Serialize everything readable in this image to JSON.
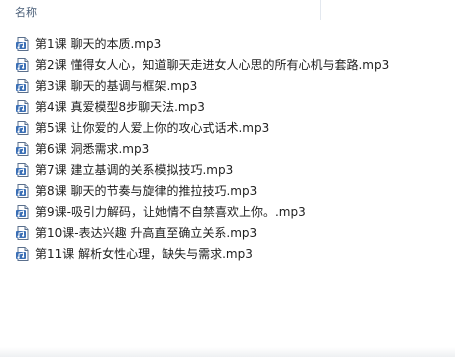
{
  "header": {
    "name_column_label": "名称"
  },
  "files": [
    {
      "name": "第1课 聊天的本质.mp3",
      "icon": "audio-file-icon"
    },
    {
      "name": "第2课 懂得女人心，知道聊天走进女人心思的所有心机与套路.mp3",
      "icon": "audio-file-icon"
    },
    {
      "name": "第3课 聊天的基调与框架.mp3",
      "icon": "audio-file-icon"
    },
    {
      "name": "第4课 真爱模型8步聊天法.mp3",
      "icon": "audio-file-icon"
    },
    {
      "name": "第5课 让你爱的人爱上你的攻心式话术.mp3",
      "icon": "audio-file-icon"
    },
    {
      "name": "第6课 洞悉需求.mp3",
      "icon": "audio-file-icon"
    },
    {
      "name": "第7课 建立基调的关系模拟技巧.mp3",
      "icon": "audio-file-icon"
    },
    {
      "name": "第8课 聊天的节奏与旋律的推拉技巧.mp3",
      "icon": "audio-file-icon"
    },
    {
      "name": "第9课-吸引力解码，让她情不自禁喜欢上你。.mp3",
      "icon": "audio-file-icon"
    },
    {
      "name": "第10课-表达兴趣 升高直至确立关系.mp3",
      "icon": "audio-file-icon"
    },
    {
      "name": "第11课 解析女性心理，缺失与需求.mp3",
      "icon": "audio-file-icon"
    }
  ]
}
